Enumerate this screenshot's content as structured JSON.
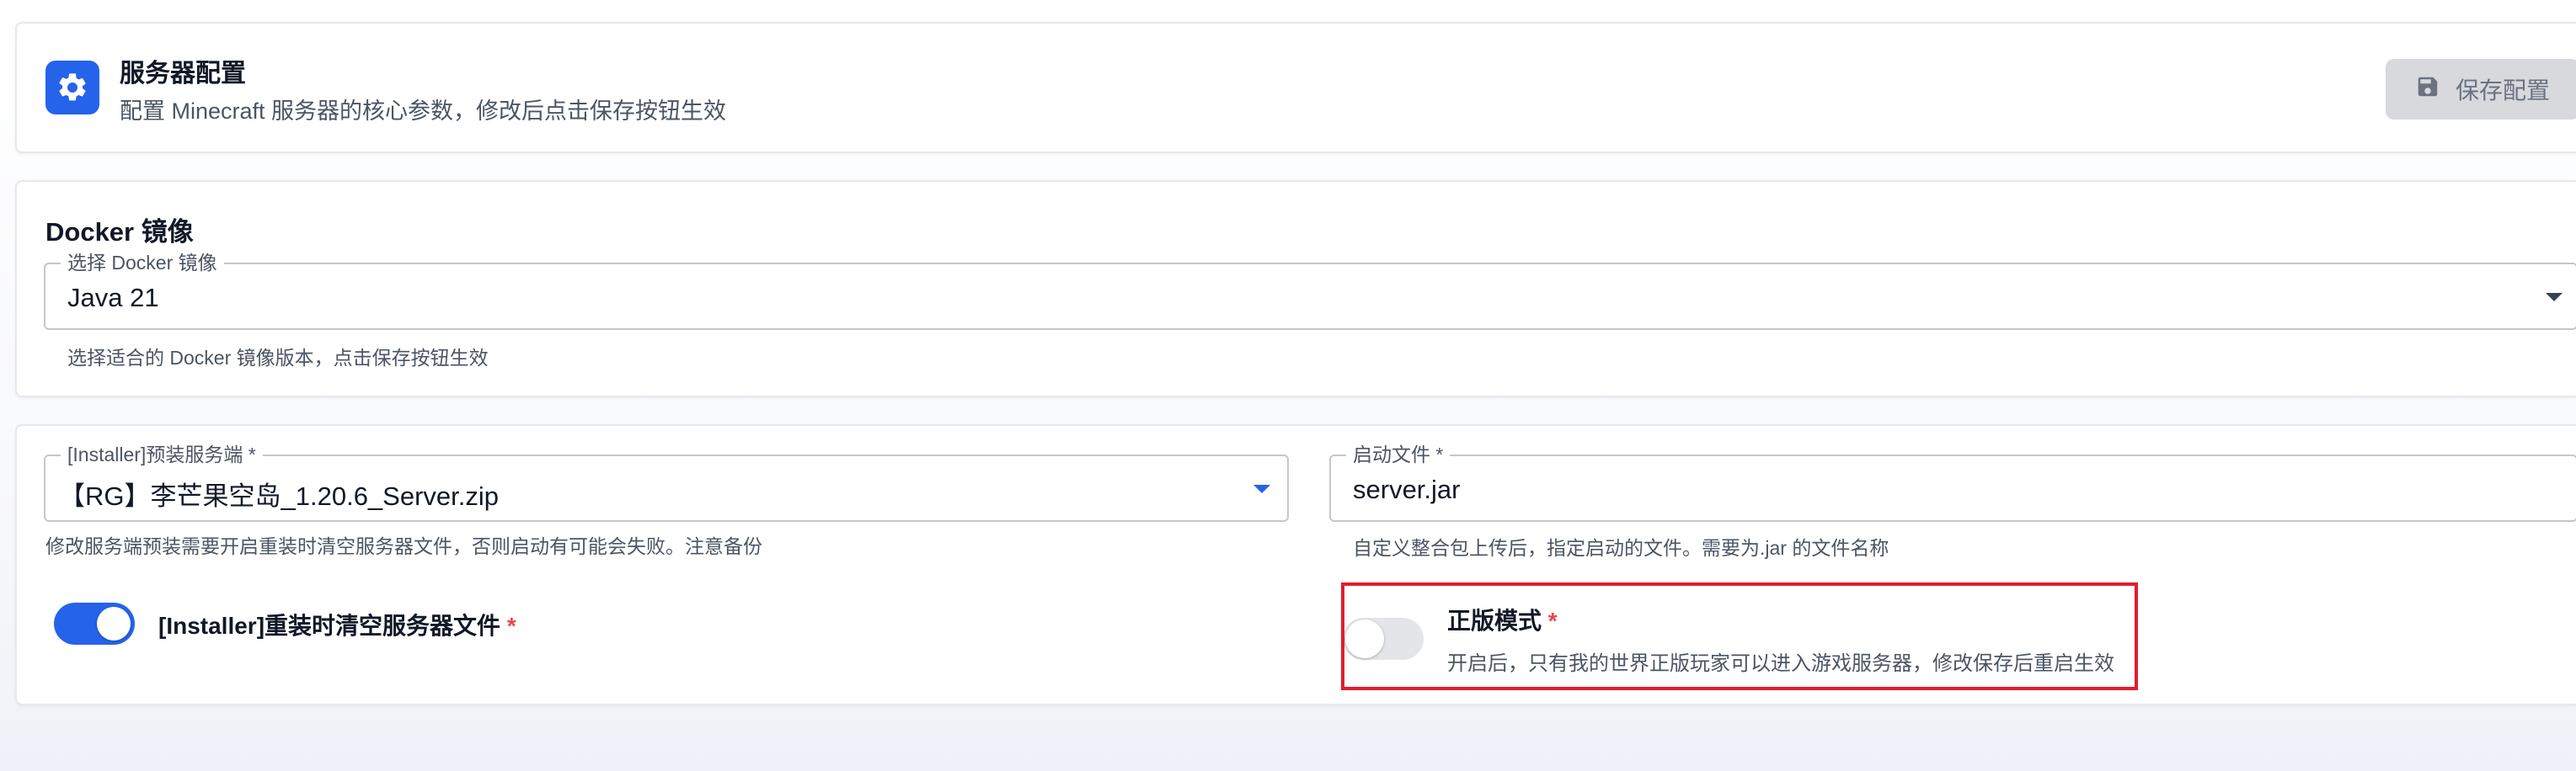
{
  "header": {
    "title": "服务器配置",
    "subtitle": "配置 Minecraft 服务器的核心参数，修改后点击保存按钮生效",
    "icon": "gear-icon",
    "save_button": {
      "label": "保存配置",
      "icon": "floppy-disk-icon",
      "disabled": true
    }
  },
  "docker": {
    "section_title": "Docker 镜像",
    "select_label": "选择 Docker 镜像",
    "select_value": "Java 21",
    "helper": "选择适合的 Docker 镜像版本，点击保存按钮生效"
  },
  "installer": {
    "server_select_label": "[Installer]预装服务端 *",
    "server_select_value": "【RG】李芒果空岛_1.20.6_Server.zip",
    "server_helper": "修改服务端预装需要开启重装时清空服务器文件，否则启动有可能会失败。注意备份",
    "startup_label": "启动文件 *",
    "startup_value": "server.jar",
    "startup_helper": "自定义整合包上传后，指定启动的文件。需要为.jar 的文件名称",
    "clear_toggle_label": "[Installer]重装时清空服务器文件",
    "clear_toggle_on": true,
    "online_mode_label": "正版模式",
    "online_mode_helper": "开启后，只有我的世界正版玩家可以进入游戏服务器，修改保存后重启生效",
    "online_mode_on": false,
    "required_mark": "*"
  },
  "colors": {
    "primary": "#2563eb",
    "required": "#e5484d",
    "highlight": "#e11d2e",
    "disabled_button": "#d7d9dd"
  }
}
